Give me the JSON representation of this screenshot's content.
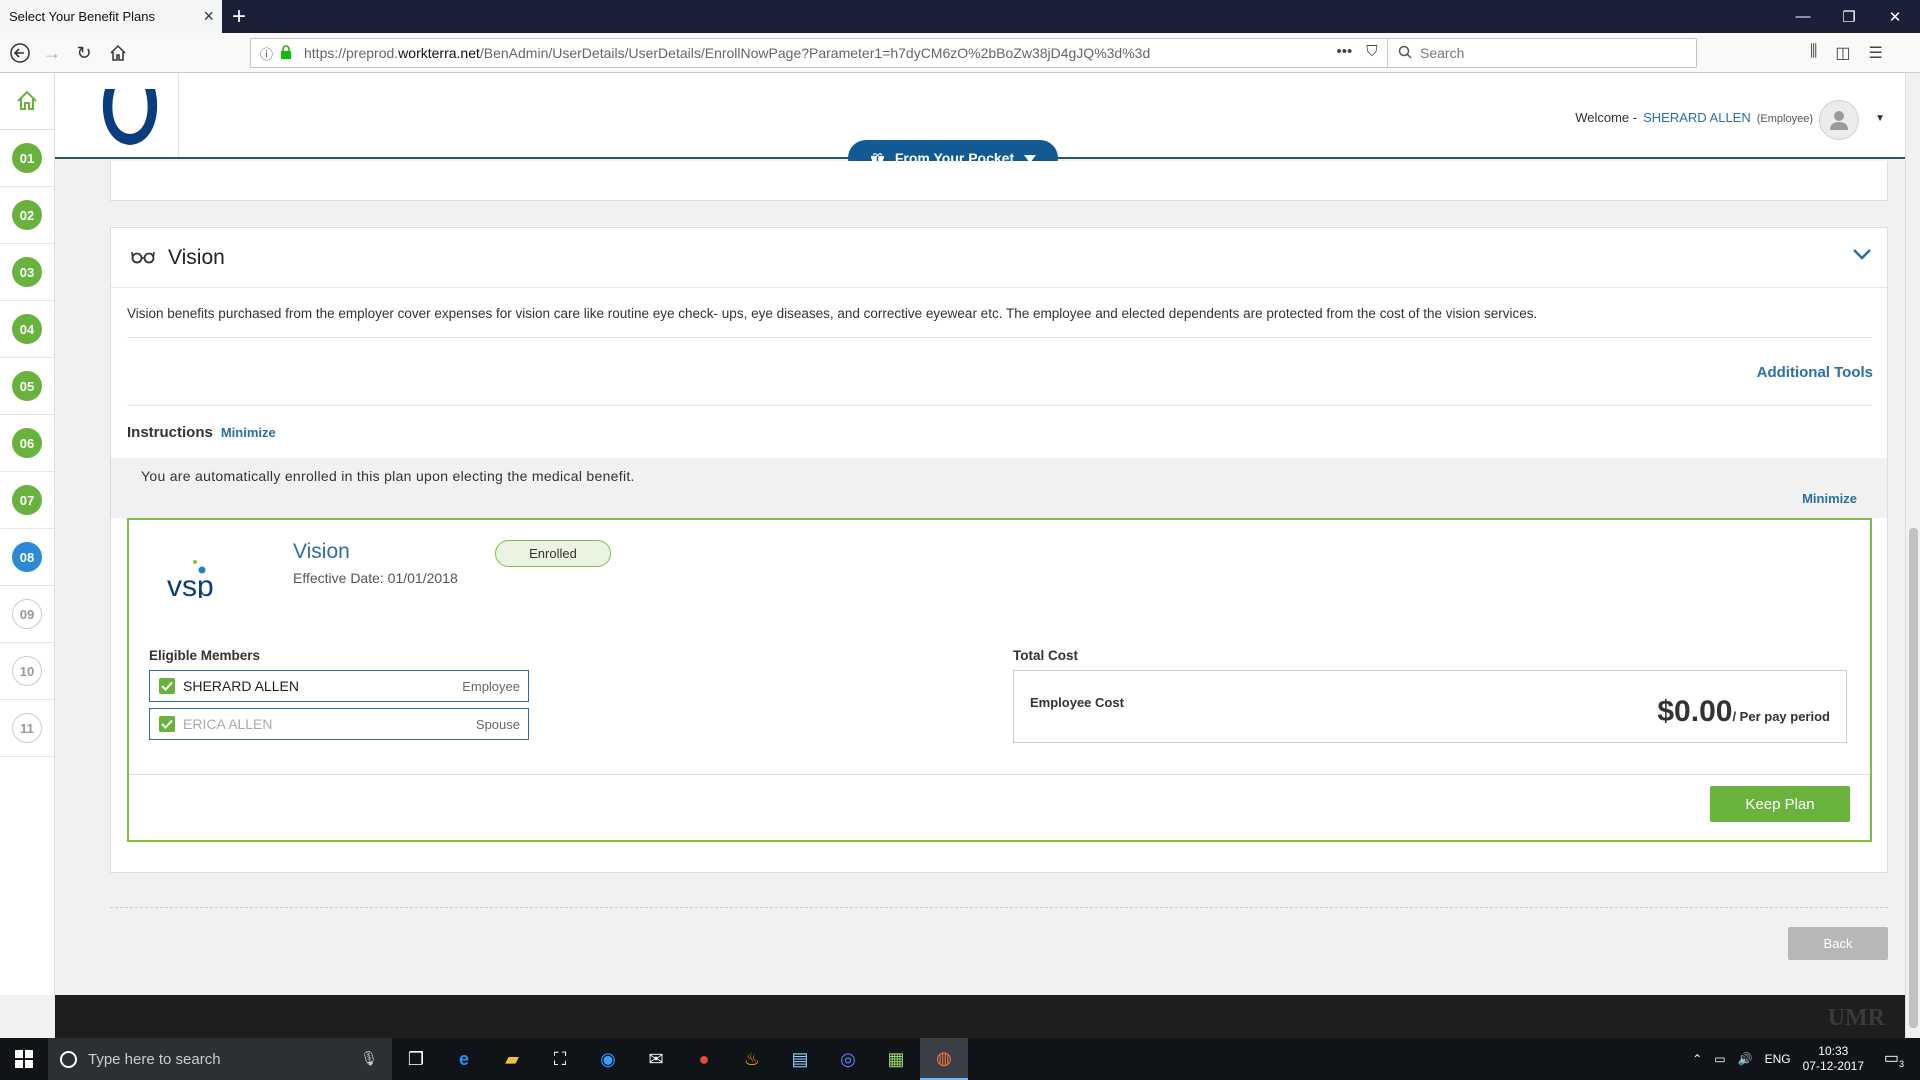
{
  "browser": {
    "tab_title": "Select Your Benefit Plans",
    "url_prefix": "https://preprod.",
    "url_host": "workterra.net",
    "url_path": "/BenAdmin/UserDetails/UserDetails/EnrollNowPage?Parameter1=h7dyCM6zO%2bBoZw38jD4gJQ%3d%3d",
    "search_placeholder": "Search",
    "menu_dots": "•••"
  },
  "steps": [
    "01",
    "02",
    "03",
    "04",
    "05",
    "06",
    "07",
    "08",
    "09",
    "10",
    "11"
  ],
  "active_step": "08",
  "header": {
    "welcome_label": "Welcome -",
    "user_name": "SHERARD ALLEN",
    "user_role": "(Employee)",
    "pocket_label": "From Your Pocket"
  },
  "benefit": {
    "title": "Vision",
    "description": "Vision benefits purchased from the employer cover expenses for vision care like routine eye check- ups, eye diseases, and corrective eyewear etc. The employee and elected dependents are protected from the cost of the vision services.",
    "additional_tools": "Additional Tools",
    "instructions_title": "Instructions",
    "instructions_minimize": "Minimize",
    "instructions_text": "You are automatically enrolled in this plan upon electing the medical benefit.",
    "plan_minimize": "Minimize"
  },
  "plan": {
    "logo_text": "vsp",
    "name": "Vision",
    "effective_date": "Effective Date: 01/01/2018",
    "status": "Enrolled",
    "eligible_label": "Eligible Members",
    "members": [
      {
        "name": "SHERARD ALLEN",
        "role": "Employee"
      },
      {
        "name": "ERICA ALLEN",
        "role": "Spouse"
      }
    ],
    "total_cost_label": "Total Cost",
    "employee_cost_label": "Employee Cost",
    "cost_value": "$0.00",
    "cost_period": "/ Per pay period",
    "keep_button": "Keep Plan"
  },
  "back_button": "Back",
  "footer_logo": "UMR",
  "taskbar": {
    "search_placeholder": "Type here to search",
    "lang": "ENG",
    "time": "10:33",
    "date": "07-12-2017",
    "notif_count": "3"
  },
  "colors": {
    "step_done": "#6ab23e",
    "step_active": "#2b89d8",
    "accent_blue": "#2a6fa8",
    "pocket_blue": "#125a94",
    "plan_border": "#7bbf4a"
  }
}
